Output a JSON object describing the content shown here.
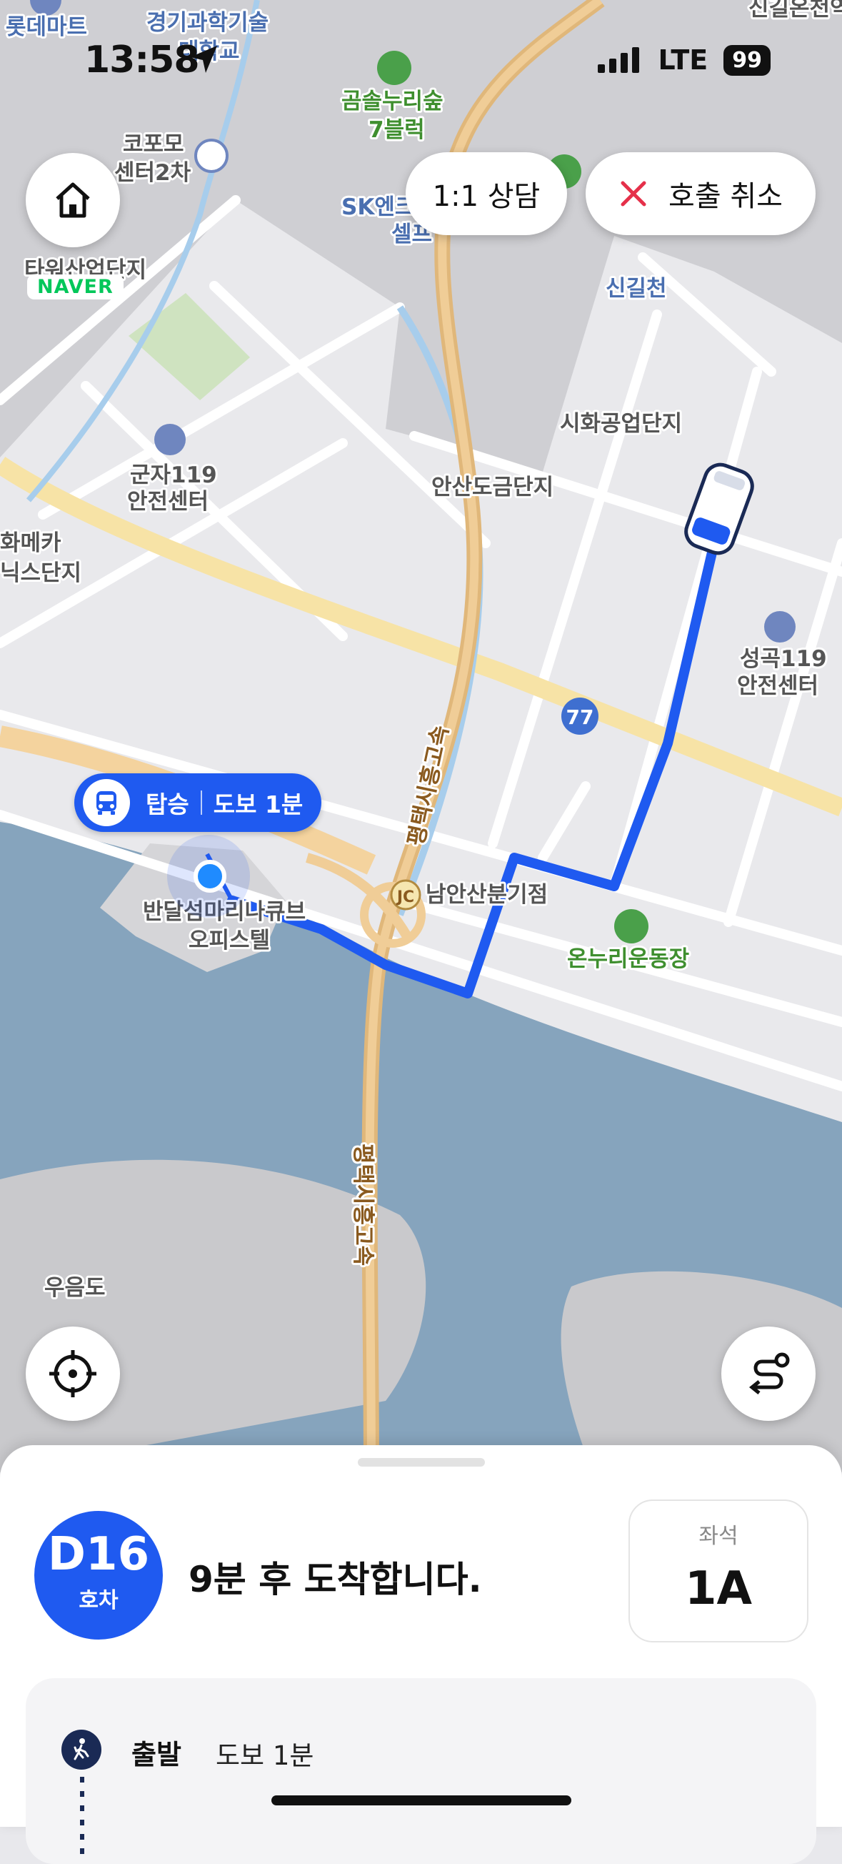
{
  "status_bar": {
    "time": "13:58",
    "network": "LTE",
    "battery": "99"
  },
  "map": {
    "labels": {
      "lotte_mart": "롯데마트",
      "gyeonggi_1": "경기과학기술",
      "gyeonggi_2": "대학교",
      "top_right": "신길온천역",
      "gomsol_1": "곰솔누리숲",
      "gomsol_2": "7블럭",
      "kopomo_1": "코포모",
      "kopomo_2": "센터2차",
      "sk_1": "SK엔크",
      "sk_2": "셀프",
      "tower": "타워산업단지",
      "singilcheon": "신길천",
      "sihwa": "시화공업단지",
      "gunja_1": "군자119",
      "gunja_2": "안전센터",
      "ansan_dogeum": "안산도금단지",
      "hwameka_1": "화메카",
      "hwameka_2": "닉스단지",
      "seonggok_1": "성곡119",
      "seonggok_2": "안전센터",
      "route_num": "77",
      "expressway_1": "평택시흥고속",
      "expressway_2": "평택시흥고속",
      "jc_badge": "JC",
      "junction": "남안산분기점",
      "bandal_1": "반달섬마리나큐브",
      "bandal_2": "오피스텔",
      "onnuri": "온누리운동장",
      "ueumdo": "우음도"
    },
    "naver_logo": "NAVER",
    "pickup": {
      "label": "탑승",
      "walk": "도보 1분"
    }
  },
  "top_buttons": {
    "consult": "1:1 상담",
    "cancel": "호출 취소"
  },
  "icons": {
    "home": "home-icon",
    "location": "location-arrow-icon",
    "recenter": "crosshair-icon",
    "route": "route-icon",
    "close": "close-icon",
    "car": "car-icon",
    "walk": "walk-icon"
  },
  "colors": {
    "accent": "#1f5af0",
    "cancel_x": "#e5304a",
    "naver_green": "#03c75a"
  },
  "sheet": {
    "car_number": "D16",
    "car_unit": "호차",
    "arrival_message": "9분 후 도착합니다.",
    "seat_title": "좌석",
    "seat_value": "1A",
    "route_steps": [
      {
        "label": "출발",
        "detail": "도보 1분"
      }
    ]
  }
}
